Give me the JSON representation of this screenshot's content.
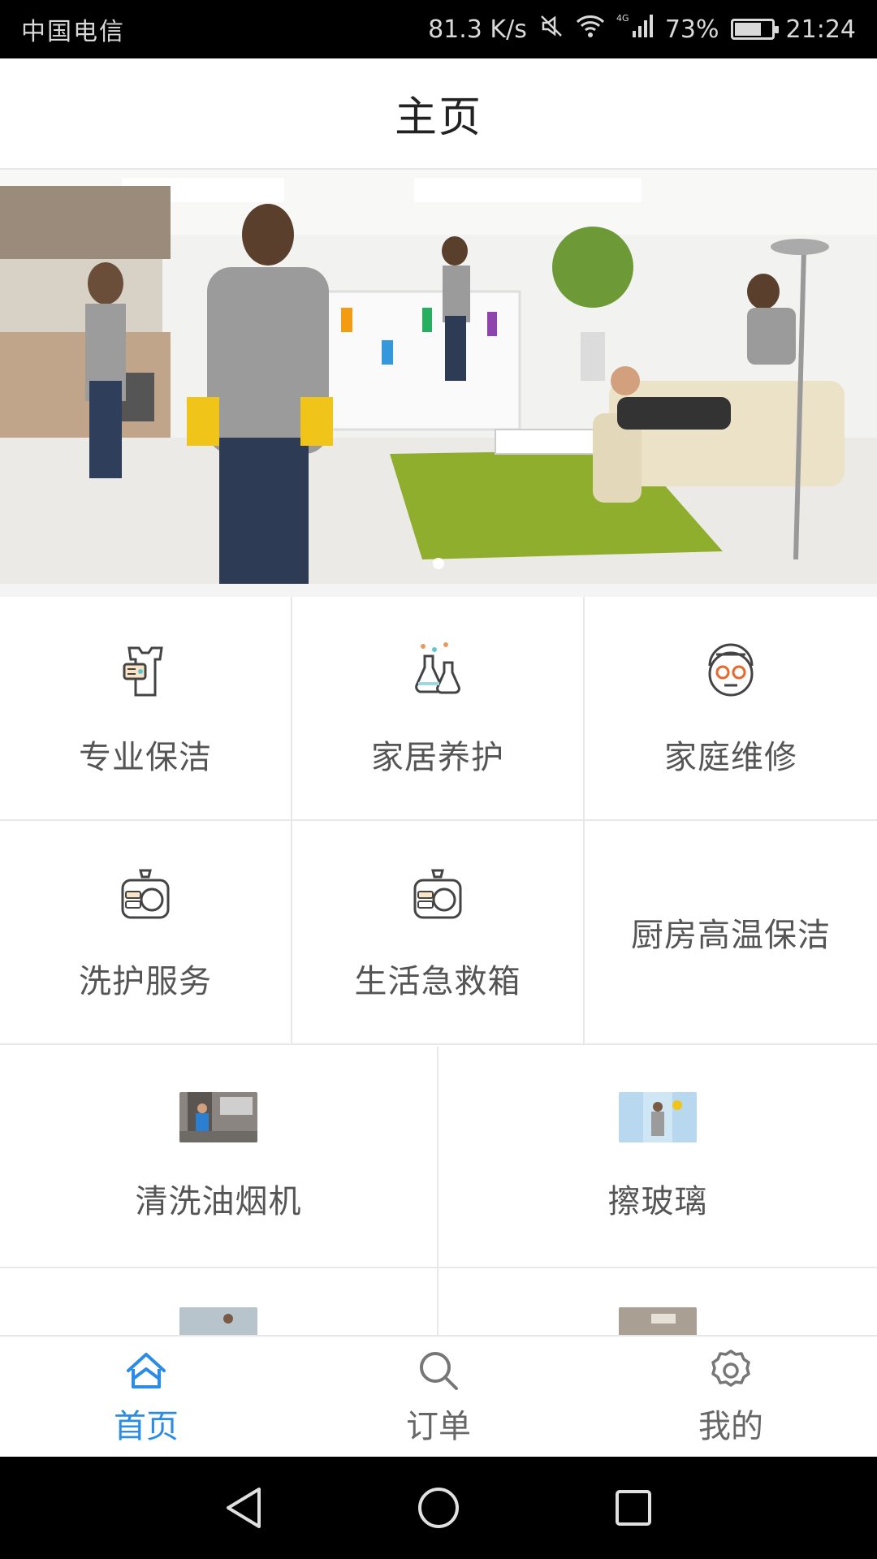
{
  "status_bar": {
    "carrier": "中国电信",
    "net_speed": "81.3 K/s",
    "network": "4G",
    "battery": "73%",
    "battery_level": 0.73,
    "time": "21:24"
  },
  "header": {
    "title": "主页"
  },
  "banner": {
    "slide_count": 1,
    "active_slide": 0
  },
  "grid": [
    {
      "label": "专业保洁",
      "icon": "uniform-icon"
    },
    {
      "label": "家居养护",
      "icon": "flask-icon"
    },
    {
      "label": "家庭维修",
      "icon": "worker-icon"
    },
    {
      "label": "洗护服务",
      "icon": "washing-machine-icon"
    },
    {
      "label": "生活急救箱",
      "icon": "washing-machine-icon"
    },
    {
      "label": "厨房高温保洁",
      "icon": ""
    }
  ],
  "services": [
    {
      "label": "清洗油烟机",
      "thumb": "range-hood-cleaning-photo"
    },
    {
      "label": "擦玻璃",
      "thumb": "window-cleaning-photo"
    }
  ],
  "bottom_nav": [
    {
      "label": "首页",
      "icon": "home-icon",
      "active": true
    },
    {
      "label": "订单",
      "icon": "search-icon",
      "active": false
    },
    {
      "label": "我的",
      "icon": "gear-icon",
      "active": false
    }
  ],
  "colors": {
    "accent": "#2a8ce6",
    "text": "#555555",
    "divider": "#e8e8e8"
  }
}
